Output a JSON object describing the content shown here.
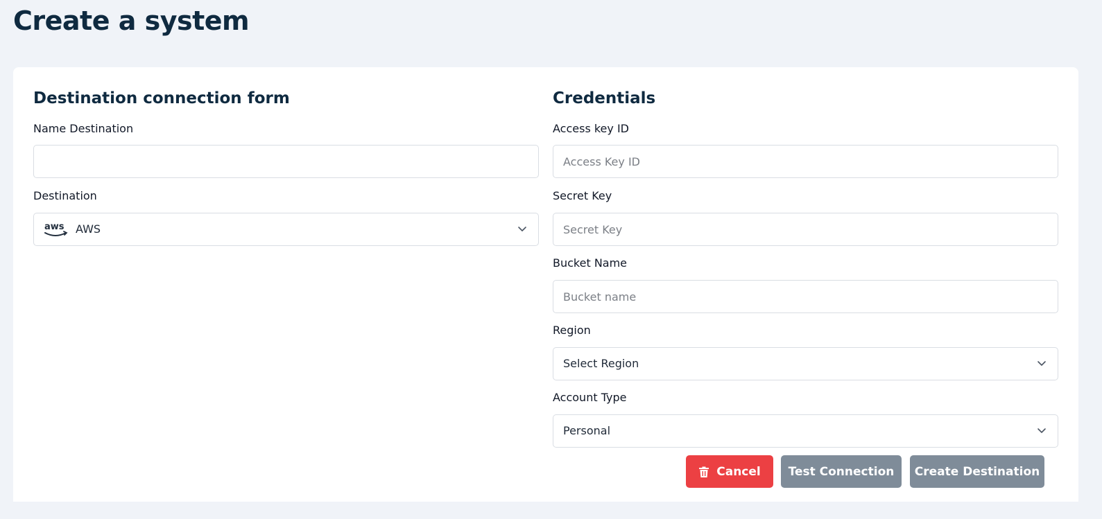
{
  "page": {
    "title": "Create a system"
  },
  "left_section": {
    "title": "Destination connection form",
    "name_destination": {
      "label": "Name Destination",
      "value": "",
      "placeholder": ""
    },
    "destination": {
      "label": "Destination",
      "value": "AWS",
      "icon": "aws-logo-icon"
    }
  },
  "right_section": {
    "title": "Credentials",
    "access_key": {
      "label": "Access key ID",
      "placeholder": "Access Key ID",
      "value": ""
    },
    "secret_key": {
      "label": "Secret Key",
      "placeholder": "Secret Key",
      "value": ""
    },
    "bucket_name": {
      "label": "Bucket Name",
      "placeholder": "Bucket name",
      "value": ""
    },
    "region": {
      "label": "Region",
      "value": "Select Region"
    },
    "account_type": {
      "label": "Account Type",
      "value": "Personal"
    }
  },
  "actions": {
    "cancel_label": "Cancel",
    "test_label": "Test Connection",
    "create_label": "Create Destination"
  },
  "colors": {
    "background": "#f0f3f8",
    "title": "#0f2a40",
    "cancel": "#ec4043",
    "disabled_button": "#7f8c99",
    "aws_smile": "#f90"
  }
}
